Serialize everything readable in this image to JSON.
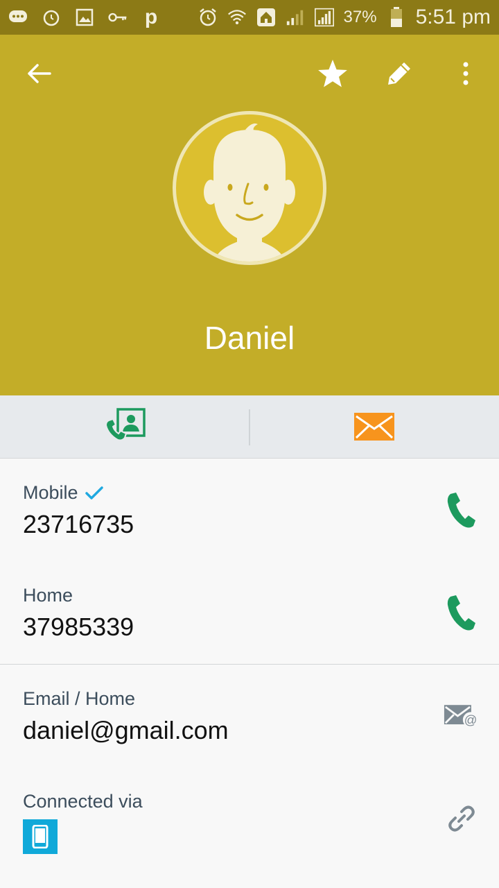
{
  "status_bar": {
    "battery": "37%",
    "time": "5:51 pm",
    "icons": [
      "message-icon",
      "alarm-icon",
      "gallery-icon",
      "key-icon",
      "p-app-icon",
      "alarm-clock-icon",
      "wifi-icon",
      "home-icon",
      "signal-icon",
      "signal-icon",
      "battery-icon"
    ],
    "p_glyph": "p"
  },
  "header": {
    "contact_name": "Daniel",
    "bg_color": "#c3ad28"
  },
  "actions": {
    "call_color": "#1d9a5e",
    "message_color": "#f7941d"
  },
  "details": {
    "mobile": {
      "label": "Mobile",
      "value": "23716735",
      "verified": true
    },
    "home": {
      "label": "Home",
      "value": "37985339"
    },
    "email": {
      "label": "Email / Home",
      "value": "daniel@gmail.com"
    },
    "connected": {
      "label": "Connected via",
      "source_icon": "phone-device-icon"
    }
  }
}
